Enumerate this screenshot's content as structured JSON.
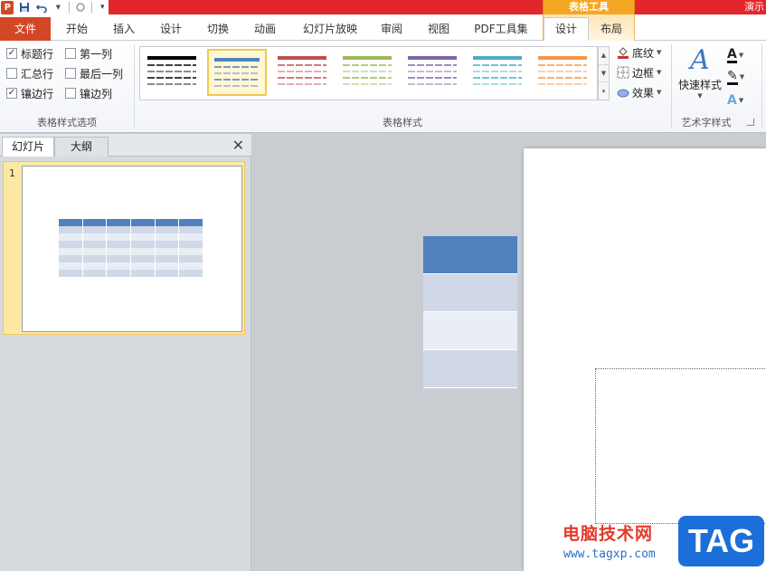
{
  "quick_access": {
    "app_letter": "P",
    "save_icon": "save-icon",
    "undo_icon": "undo-icon",
    "redo_icon": "redo-icon",
    "customize_icon": "qat-dropdown-icon"
  },
  "title": {
    "contextual_group": "表格工具",
    "window_title": "演示"
  },
  "tabs": [
    {
      "label": "文件"
    },
    {
      "label": "开始"
    },
    {
      "label": "插入"
    },
    {
      "label": "设计"
    },
    {
      "label": "切换"
    },
    {
      "label": "动画"
    },
    {
      "label": "幻灯片放映"
    },
    {
      "label": "审阅"
    },
    {
      "label": "视图"
    },
    {
      "label": "PDF工具集"
    },
    {
      "label": "设计"
    },
    {
      "label": "布局"
    }
  ],
  "ribbon": {
    "options_group": {
      "label": "表格样式选项",
      "items": [
        {
          "label": "标题行",
          "checked": true
        },
        {
          "label": "第一列",
          "checked": false
        },
        {
          "label": "汇总行",
          "checked": false
        },
        {
          "label": "最后一列",
          "checked": false
        },
        {
          "label": "镶边行",
          "checked": true
        },
        {
          "label": "镶边列",
          "checked": false
        }
      ],
      "check_mark": "✓"
    },
    "styles_group": {
      "label": "表格样式",
      "swatches": [
        "#000000",
        "#4f81bd",
        "#c0504d",
        "#9bbb59",
        "#8064a2",
        "#4bacc6",
        "#f79646"
      ],
      "selected_index": 1,
      "shading": "底纹",
      "borders": "边框",
      "effects": "效果"
    },
    "wordart_group": {
      "label": "艺术字样式",
      "quick_styles": "快速样式",
      "quick_styles_glyph": "A"
    }
  },
  "left_panel": {
    "tabs": [
      "幻灯片",
      "大纲"
    ],
    "close_glyph": "✕",
    "slide_number": "1",
    "thumb_header_color": "#4f81bd",
    "thumb_band_colors": [
      "#d0d8e8",
      "#e9edf4"
    ]
  },
  "editor": {
    "table_header_color": "#4f81bd",
    "table_band_colors": [
      "#d0d8e8",
      "#e9edf4"
    ]
  },
  "watermark": {
    "site_name": "电脑技术网",
    "url": "www.tagxp.com",
    "logo": "TAG"
  }
}
